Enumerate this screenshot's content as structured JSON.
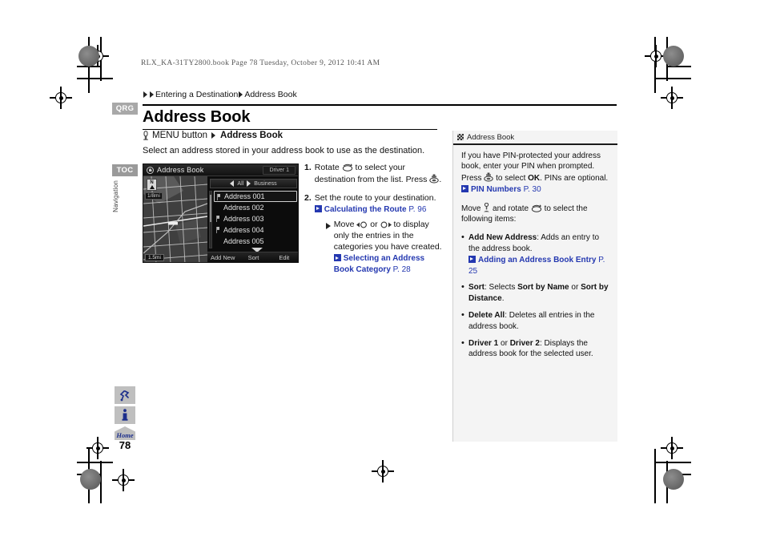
{
  "book_meta": "RLX_KA-31TY2800.book  Page 78  Tuesday, October 9, 2012  10:41 AM",
  "breadcrumb": {
    "part1": "Entering a Destination",
    "part2": "Address Book"
  },
  "page_title": "Address Book",
  "page_number": "78",
  "tabs": {
    "qrg": "QRG",
    "toc": "TOC",
    "vertical_label": "Navigation"
  },
  "side_icons": {
    "route": "route-icon",
    "info": "info-icon",
    "home": "Home"
  },
  "menu_path": {
    "prefix": "MENU button",
    "target": "Address Book"
  },
  "intro": "Select an address stored in your address book to use as the destination.",
  "nav_screen": {
    "title": "Address Book",
    "driver_badge": "Driver 1",
    "scale_top": "1/8mi",
    "scale_bottom": "1.5mi",
    "compass_letter": "N",
    "category_left": "All",
    "category_right": "Business",
    "entries": [
      {
        "label": "Address 001",
        "selected": true,
        "pin": true
      },
      {
        "label": "Address 002",
        "selected": false,
        "pin": false
      },
      {
        "label": "Address 003",
        "selected": false,
        "pin": true
      },
      {
        "label": "Address 004",
        "selected": false,
        "pin": true
      },
      {
        "label": "Address 005",
        "selected": false,
        "pin": false
      }
    ],
    "bottom_buttons": [
      "Add New",
      "Sort",
      "Edit"
    ]
  },
  "steps": [
    {
      "number": "1.",
      "text_a": "Rotate ",
      "text_b": " to select your destination from the list. Press ",
      "text_c": "."
    },
    {
      "number": "2.",
      "text": "Set the route to your destination.",
      "link": "Calculating the Route",
      "link_page": "P. 96",
      "note_a": "Move ",
      "note_b": " or ",
      "note_c": " to display only the entries in the categories you have created.",
      "note_link": "Selecting an Address Book Category",
      "note_link_page": "P. 28"
    }
  ],
  "panel": {
    "heading": "Address Book",
    "para1_a": "If you have PIN-protected your address book, enter your PIN when prompted. Press ",
    "para1_b": " to select ",
    "para1_ok": "OK",
    "para1_c": ". PINs are optional.",
    "link1": "PIN Numbers",
    "link1_page": "P. 30",
    "para2_a": "Move ",
    "para2_b": " and rotate ",
    "para2_c": " to select the following items:",
    "items": [
      {
        "term": "Add New Address",
        "desc": ": Adds an entry to the address book.",
        "link": "Adding an Address Book Entry",
        "link_page": "P. 25"
      },
      {
        "term": "Sort",
        "desc_a": ": Selects ",
        "bold_a": "Sort by Name",
        "desc_b": " or ",
        "bold_b": "Sort by Distance",
        "desc_c": "."
      },
      {
        "term": "Delete All",
        "desc": ": Deletes all entries in the address book."
      },
      {
        "term_a": "Driver 1",
        "mid": " or ",
        "term_b": "Driver 2",
        "desc": ": Displays the address book for the selected user."
      }
    ]
  },
  "colors": {
    "link_blue": "#2438b0",
    "tab_gray": "#a8a8a8",
    "panel_bg": "#f4f4f4"
  }
}
